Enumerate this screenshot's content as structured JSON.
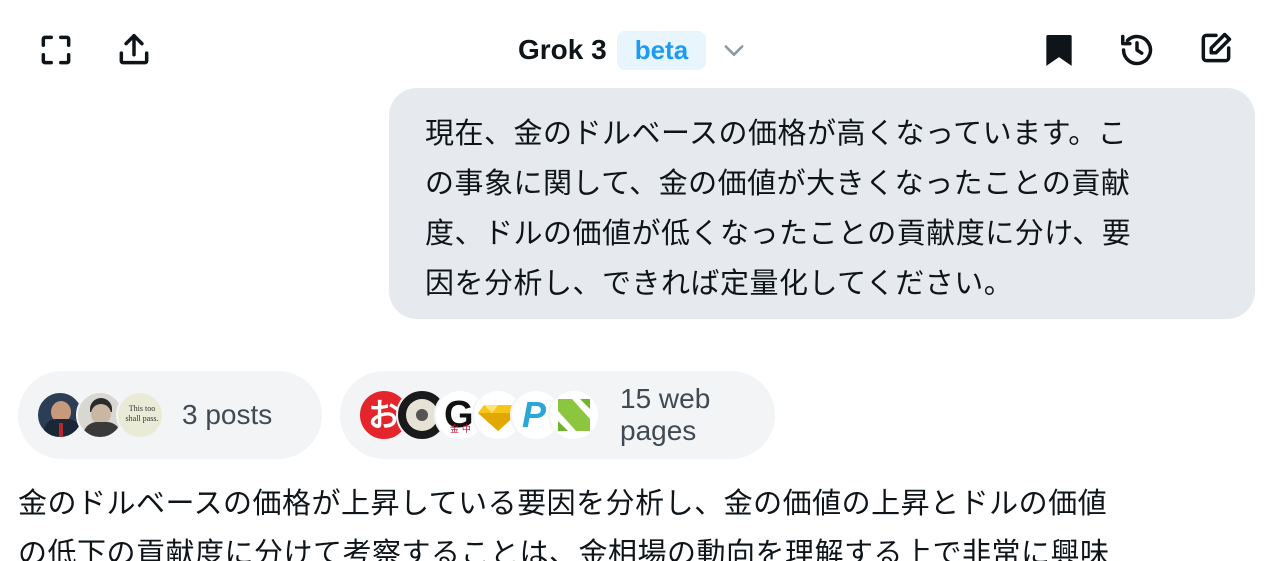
{
  "header": {
    "title": "Grok 3",
    "badge": "beta",
    "icons": {
      "left": [
        "expand-icon",
        "share-icon"
      ],
      "right": [
        "bookmark-icon",
        "history-icon",
        "compose-icon"
      ],
      "dropdown": "chevron-down-icon"
    }
  },
  "user_message": {
    "lines": [
      "現在、金のドルベースの価格が高くなっています。こ",
      "の事象に関して、金の価値が大きくなったことの貢献",
      "度、ドルの価値が低くなったことの貢献度に分け、要",
      "因を分析し、できれば定量化してください。"
    ]
  },
  "sources": {
    "posts_label": "3 posts",
    "web_label": "15 web pages",
    "post_avatar_text": "This too shall pass."
  },
  "answer": {
    "lines": [
      "金のドルベースの価格が上昇している要因を分析し、金の価値の上昇とドルの価値",
      "の低下の貢献度に分けて考察することは、金相場の動向を理解する上で非常に興味"
    ]
  },
  "colors": {
    "bubble_bg": "#e6e9ed",
    "chip_bg": "#f2f4f6",
    "badge_bg": "#e8f5fd",
    "badge_fg": "#1d9bf0",
    "text": "#0f1419"
  }
}
